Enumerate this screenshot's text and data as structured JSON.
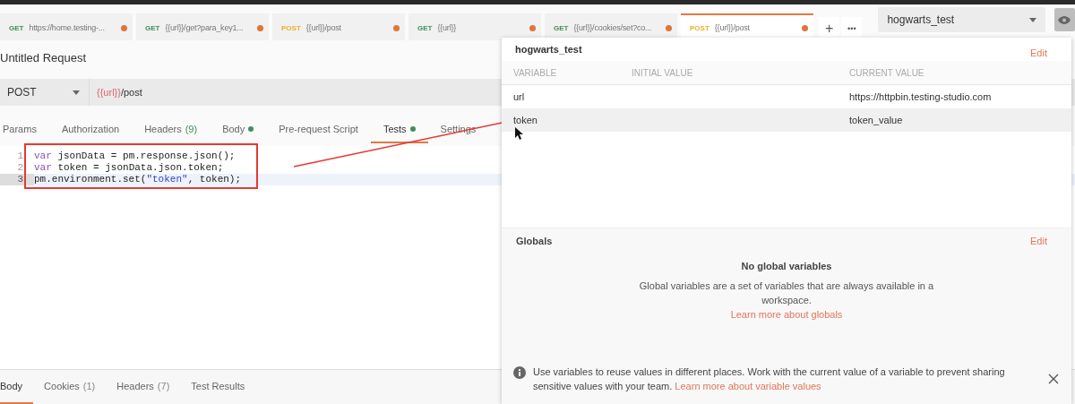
{
  "tabs": [
    {
      "method": "GET",
      "label": "https://home.testing-...",
      "unsaved": true,
      "selected": false
    },
    {
      "method": "GET",
      "label": "{{url}}/get?para_key1...",
      "unsaved": true,
      "selected": false
    },
    {
      "method": "POST",
      "label": "{{url}}/post",
      "unsaved": true,
      "selected": false
    },
    {
      "method": "GET",
      "label": "{{url}}",
      "unsaved": true,
      "selected": false
    },
    {
      "method": "GET",
      "label": "{{url}}/cookies/set?co...",
      "unsaved": true,
      "selected": false
    },
    {
      "method": "POST",
      "label": "{{url}}/post",
      "unsaved": true,
      "selected": true
    }
  ],
  "new_tab": "+",
  "more": "•••",
  "environment": {
    "value": "hogwarts_test"
  },
  "request": {
    "title": "Untitled Request",
    "method": "POST",
    "url_var": "{{url}}",
    "url_path": "/post"
  },
  "request_tabs": [
    {
      "label": "Params",
      "selected": false
    },
    {
      "label": "Authorization",
      "selected": false
    },
    {
      "label": "Headers",
      "count": "(9)",
      "selected": false
    },
    {
      "label": "Body",
      "dot": true,
      "selected": false
    },
    {
      "label": "Pre-request Script",
      "selected": false
    },
    {
      "label": "Tests",
      "dot": true,
      "selected": true
    },
    {
      "label": "Settings",
      "selected": false
    }
  ],
  "code": [
    {
      "number": "1",
      "active": false,
      "tokens": [
        {
          "kind": "keyword",
          "text": "var"
        },
        {
          "kind": "plain",
          "text": " jsonData = pm.response.json();"
        }
      ]
    },
    {
      "number": "2",
      "active": false,
      "tokens": [
        {
          "kind": "keyword",
          "text": "var"
        },
        {
          "kind": "plain",
          "text": " token = jsonData.json.token;"
        }
      ]
    },
    {
      "number": "3",
      "active": true,
      "tokens": [
        {
          "kind": "plain",
          "text": "pm.environment.set("
        },
        {
          "kind": "string",
          "text": "\"token\""
        },
        {
          "kind": "plain",
          "text": ", token);"
        }
      ]
    }
  ],
  "response_tabs": [
    {
      "label": "Body",
      "selected": true
    },
    {
      "label": "Cookies",
      "count": "(1)",
      "selected": false
    },
    {
      "label": "Headers",
      "count": "(7)",
      "selected": false
    },
    {
      "label": "Test Results",
      "selected": false
    }
  ],
  "popup": {
    "env_name": "hogwarts_test",
    "edit": "Edit",
    "columns": [
      "VARIABLE",
      "INITIAL VALUE",
      "CURRENT VALUE"
    ],
    "rows": [
      {
        "variable": "url",
        "current": "https://httpbin.testing-studio.com",
        "selected": false
      },
      {
        "variable": "token",
        "current": "token_value",
        "selected": true
      }
    ],
    "globals_title": "Globals",
    "globals_edit": "Edit",
    "empty_title": "No global variables",
    "empty_text": "Global variables are a set of variables that are always available in a workspace.",
    "empty_link": "Learn more about globals",
    "info_text": "Use variables to reuse values in different places. Work with the current value of a variable to prevent sharing sensitive values with your team.",
    "info_link": "Learn more about variable values"
  }
}
